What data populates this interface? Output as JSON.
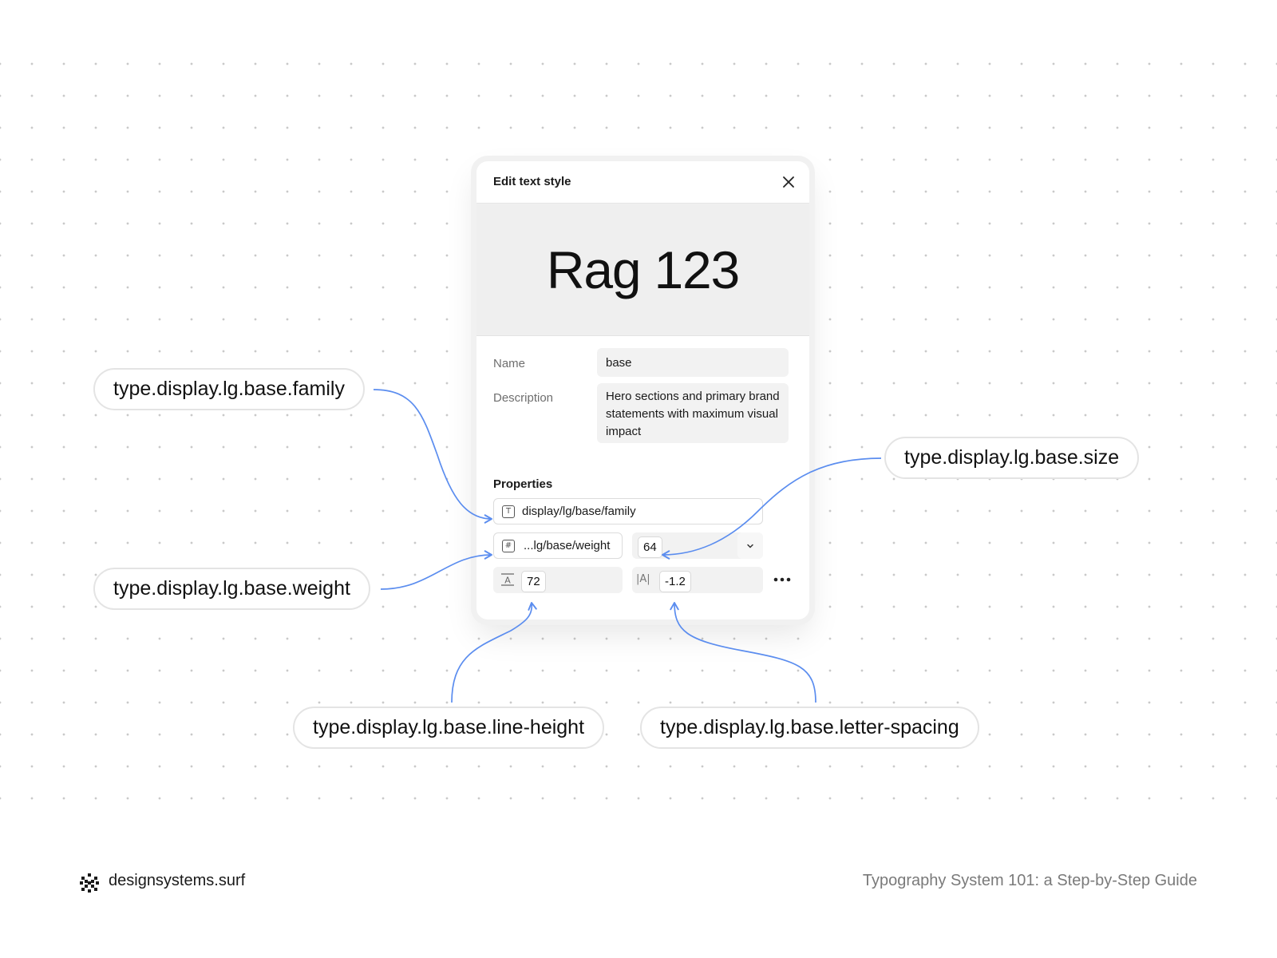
{
  "panel": {
    "title": "Edit text style",
    "preview_text": "Rag 123",
    "name_label": "Name",
    "name_value": "base",
    "description_label": "Description",
    "description_value": "Hero sections and primary brand statements with maximum visual impact",
    "properties_title": "Properties",
    "family_value": "display/lg/base/family",
    "weight_value": "...lg/base/weight",
    "size_value": "64",
    "line_height_value": "72",
    "letter_spacing_icon": "|A|",
    "letter_spacing_value": "-1.2"
  },
  "callouts": {
    "family": "type.display.lg.base.family",
    "weight": "type.display.lg.base.weight",
    "size": "type.display.lg.base.size",
    "line_height": "type.display.lg.base.line-height",
    "letter_spacing": "type.display.lg.base.letter-spacing"
  },
  "footer": {
    "brand": "designsystems.surf",
    "caption": "Typography System 101: a Step-by-Step Guide"
  },
  "colors": {
    "connector": "#5b8def",
    "dots": "#c9c9c9"
  }
}
